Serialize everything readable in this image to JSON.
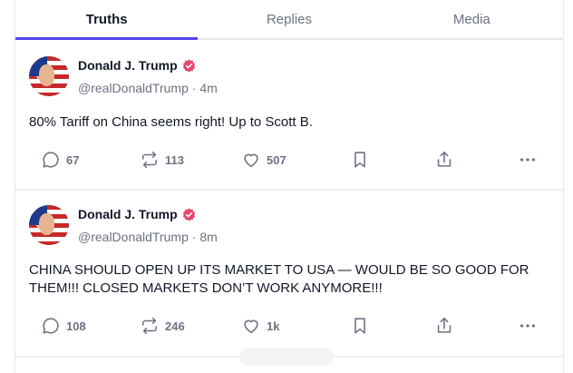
{
  "tabs": [
    {
      "label": "Truths",
      "active": true
    },
    {
      "label": "Replies",
      "active": false
    },
    {
      "label": "Media",
      "active": false
    }
  ],
  "posts": [
    {
      "author": "Donald J. Trump",
      "handle": "@realDonaldTrump",
      "time": "4m",
      "text": "80% Tariff on China seems right! Up to Scott B.",
      "replies": "67",
      "retruths": "113",
      "likes": "507"
    },
    {
      "author": "Donald J. Trump",
      "handle": "@realDonaldTrump",
      "time": "8m",
      "text": "CHINA SHOULD OPEN UP ITS MARKET TO USA — WOULD BE SO GOOD FOR THEM!!! CLOSED MARKETS DON’T WORK ANYMORE!!!",
      "replies": "108",
      "retruths": "246",
      "likes": "1k"
    }
  ],
  "separator": " · ",
  "colors": {
    "accent": "#5448ee",
    "verified": "#e8476b",
    "muted": "#6b7280"
  }
}
